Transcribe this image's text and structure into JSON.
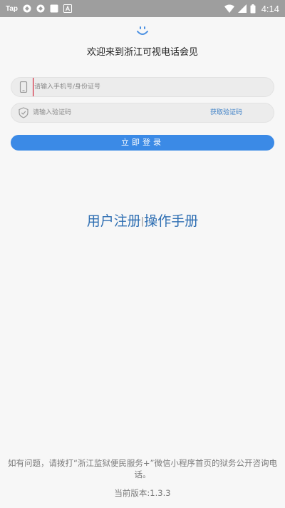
{
  "status_bar": {
    "carrier": "Tap",
    "time": "4:14"
  },
  "header": {
    "welcome": "欢迎来到浙江可视电话会见"
  },
  "form": {
    "phone_placeholder": "请输入手机号/身份证号",
    "code_placeholder": "请输入验证码",
    "get_code_label": "获取验证码",
    "login_label": "立即登录"
  },
  "links": {
    "register": "用户注册",
    "separator": "|",
    "manual": "操作手册"
  },
  "footer": {
    "help": "如有问题，请拨打“浙江监狱便民服务+”微信小程序首页的狱务公开咨询电话。",
    "version": "当前版本:1.3.3"
  },
  "colors": {
    "accent": "#3b8ae6",
    "link": "#2f6fb3",
    "status_bar": "#9e9e9e"
  }
}
